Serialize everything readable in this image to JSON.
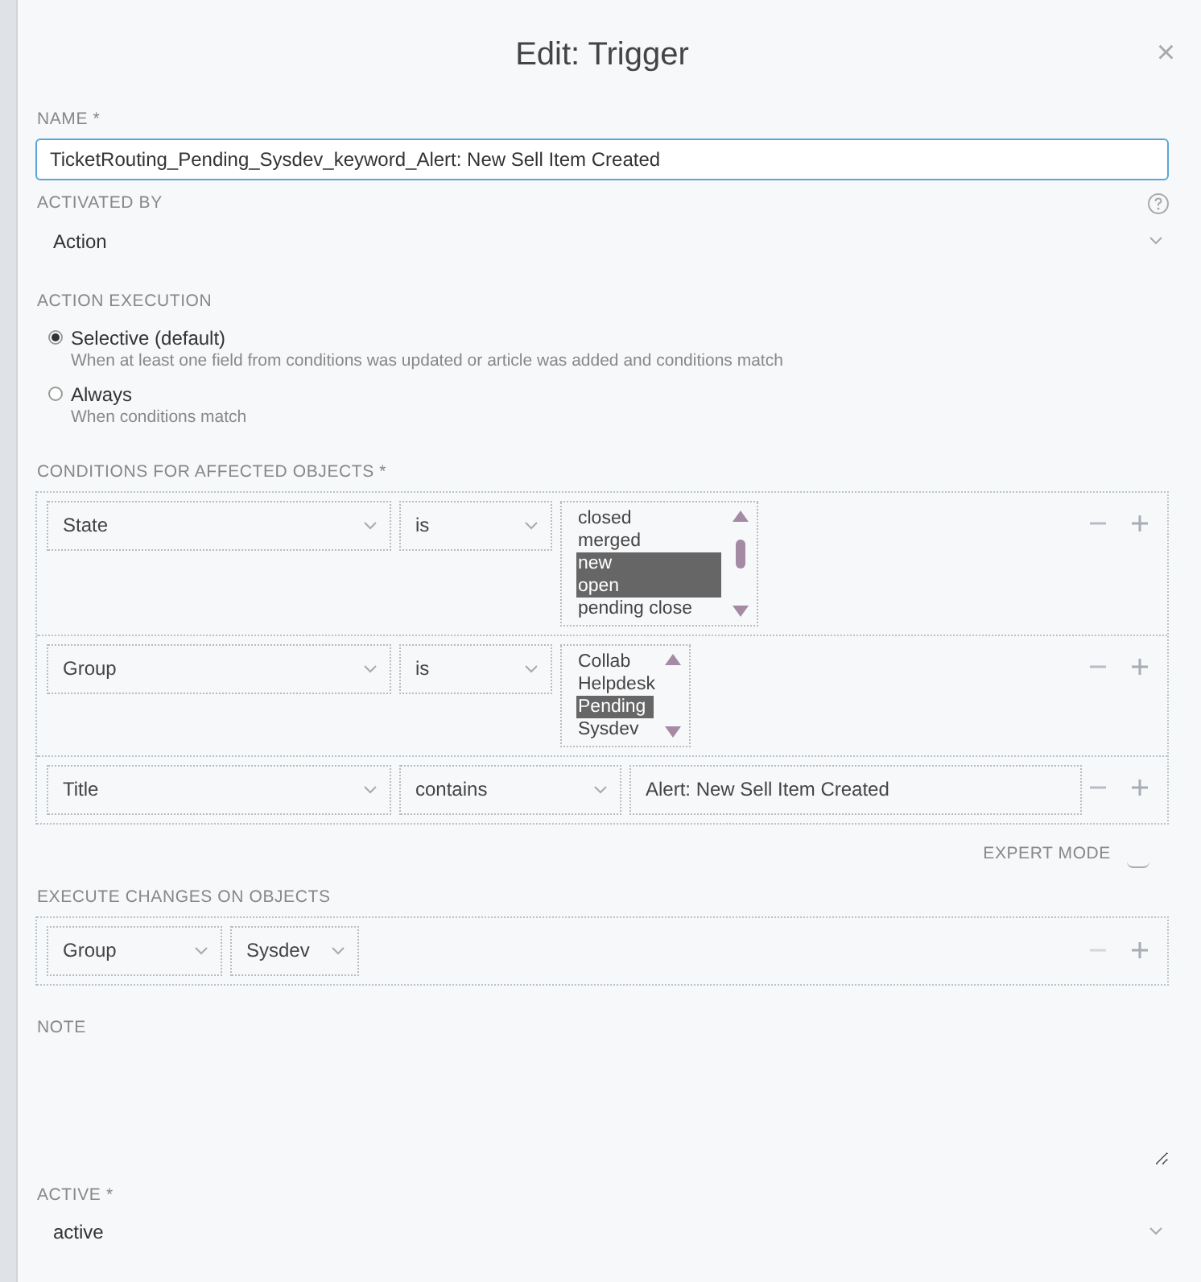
{
  "dialog": {
    "title": "Edit: Trigger",
    "close": "×"
  },
  "name": {
    "label": "NAME *",
    "value": "TicketRouting_Pending_Sysdev_keyword_Alert: New Sell Item Created"
  },
  "activated_by": {
    "label": "ACTIVATED BY",
    "value": "Action"
  },
  "action_execution": {
    "label": "ACTION EXECUTION",
    "options": [
      {
        "label": "Selective (default)",
        "hint": "When at least one field from conditions was updated or article was added and conditions match",
        "selected": true
      },
      {
        "label": "Always",
        "hint": "When conditions match",
        "selected": false
      }
    ]
  },
  "conditions": {
    "label": "CONDITIONS FOR AFFECTED OBJECTS *",
    "rows": [
      {
        "kind": "multi",
        "attribute": "State",
        "operator": "is",
        "options": [
          {
            "label": "closed",
            "selected": false
          },
          {
            "label": "merged",
            "selected": false
          },
          {
            "label": "new",
            "selected": true
          },
          {
            "label": "open",
            "selected": true
          },
          {
            "label": "pending close",
            "selected": false
          }
        ]
      },
      {
        "kind": "multi",
        "attribute": "Group",
        "operator": "is",
        "options": [
          {
            "label": "Collab",
            "selected": false
          },
          {
            "label": "Helpdesk",
            "selected": false
          },
          {
            "label": "Pending",
            "selected": true
          },
          {
            "label": "Sysdev",
            "selected": false
          }
        ]
      },
      {
        "kind": "text",
        "attribute": "Title",
        "operator": "contains",
        "value": "Alert: New Sell Item Created"
      }
    ]
  },
  "expert_mode": {
    "label": "EXPERT MODE",
    "on": false
  },
  "execute": {
    "label": "EXECUTE CHANGES ON OBJECTS",
    "rows": [
      {
        "attribute": "Group",
        "value": "Sysdev",
        "remove_disabled": true
      }
    ]
  },
  "note": {
    "label": "NOTE"
  },
  "active": {
    "label": "ACTIVE *",
    "value": "active"
  }
}
